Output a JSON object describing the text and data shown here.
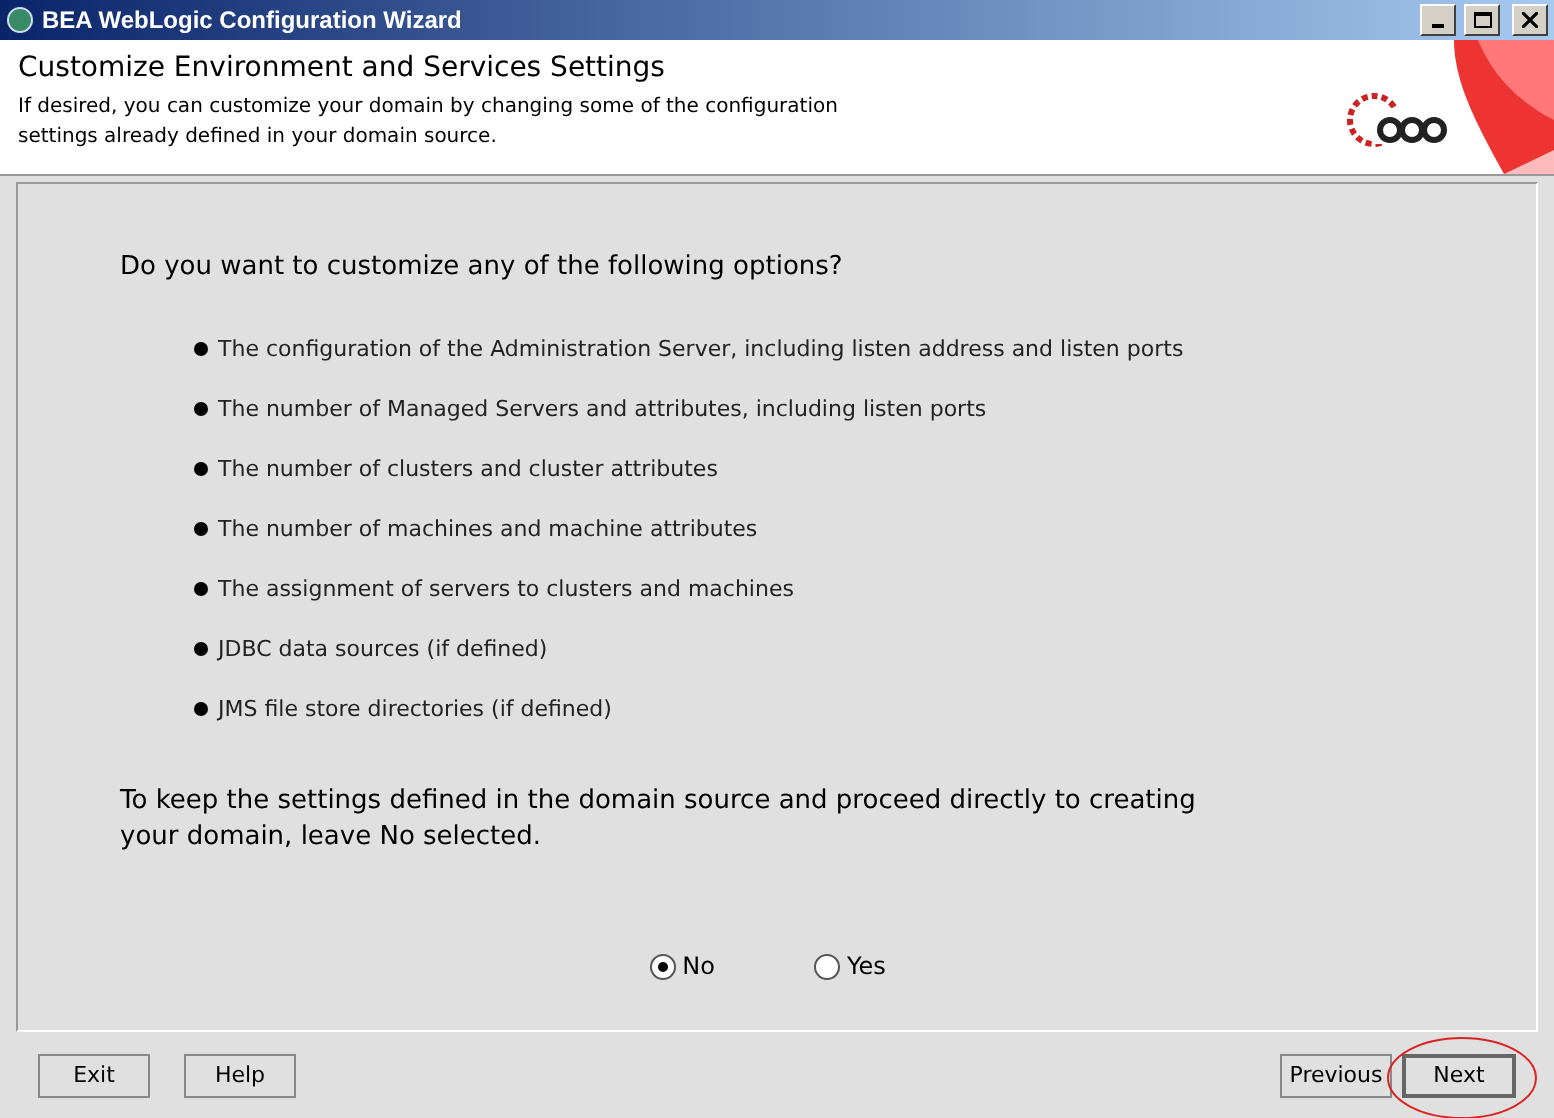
{
  "window": {
    "title": "BEA WebLogic Configuration Wizard"
  },
  "header": {
    "title": "Customize Environment and Services Settings",
    "description": "If desired, you can customize your domain by changing some of the configuration settings already defined in your domain source."
  },
  "question": "Do you want to customize any of the following options?",
  "options": [
    "The configuration of the Administration Server, including listen address and listen ports",
    "The number of Managed Servers and attributes, including listen ports",
    "The number of clusters and cluster attributes",
    "The number of machines and machine attributes",
    "The assignment of servers to clusters and machines",
    "JDBC data sources (if defined)",
    "JMS file store directories (if defined)"
  ],
  "note": "To keep the settings defined in the domain source and proceed directly to creating your domain, leave No selected.",
  "choices": [
    {
      "label": "No",
      "selected": true
    },
    {
      "label": "Yes",
      "selected": false
    }
  ],
  "buttons_left": [
    {
      "label": "Exit",
      "highlighted": false
    },
    {
      "label": "Help",
      "highlighted": false
    }
  ],
  "buttons_right": [
    {
      "label": "Previous",
      "highlighted": false
    },
    {
      "label": "Next",
      "highlighted": true
    }
  ]
}
